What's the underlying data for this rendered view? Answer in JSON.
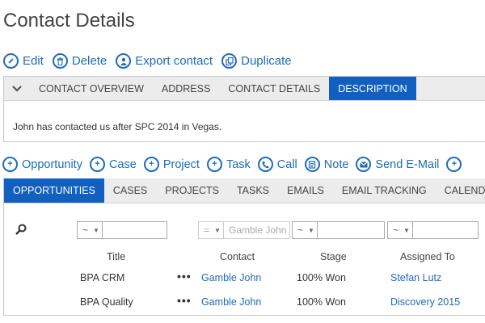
{
  "page": {
    "title": "Contact Details"
  },
  "actions": [
    {
      "label": "Edit",
      "icon": "edit-icon"
    },
    {
      "label": "Delete",
      "icon": "trash-icon"
    },
    {
      "label": "Export contact",
      "icon": "user-icon"
    },
    {
      "label": "Duplicate",
      "icon": "copy-icon"
    }
  ],
  "detail_tabs": [
    "CONTACT OVERVIEW",
    "ADDRESS",
    "CONTACT DETAILS",
    "DESCRIPTION"
  ],
  "detail_active_tab": "DESCRIPTION",
  "description_text": "John has contacted us after SPC 2014 in Vegas.",
  "add_actions": [
    {
      "label": "Opportunity",
      "icon": "plus-circle-icon"
    },
    {
      "label": "Case",
      "icon": "plus-circle-icon"
    },
    {
      "label": "Project",
      "icon": "plus-circle-icon"
    },
    {
      "label": "Task",
      "icon": "plus-circle-icon"
    },
    {
      "label": "Call",
      "icon": "phone-icon"
    },
    {
      "label": "Note",
      "icon": "note-icon"
    },
    {
      "label": "Send E-Mail",
      "icon": "mail-icon"
    }
  ],
  "grid_tabs": [
    "OPPORTUNITIES",
    "CASES",
    "PROJECTS",
    "TASKS",
    "EMAILS",
    "EMAIL TRACKING",
    "CALENDAR"
  ],
  "grid_active_tab": "OPPORTUNITIES",
  "filters": {
    "title_op": "~",
    "contact_op": "=",
    "contact_value": "Gamble John",
    "stage_op": "~",
    "assigned_op": "~"
  },
  "columns": [
    "Title",
    "Contact",
    "Stage",
    "Assigned To"
  ],
  "rows": [
    {
      "title": "BPA CRM",
      "contact": "Gamble John",
      "stage": "100% Won",
      "assigned": "Stefan Lutz"
    },
    {
      "title": "BPA Quality",
      "contact": "Gamble John",
      "stage": "100% Won",
      "assigned": "Discovery 2015"
    }
  ],
  "colors": {
    "accent": "#1160c0",
    "link": "#1e6bb8"
  }
}
